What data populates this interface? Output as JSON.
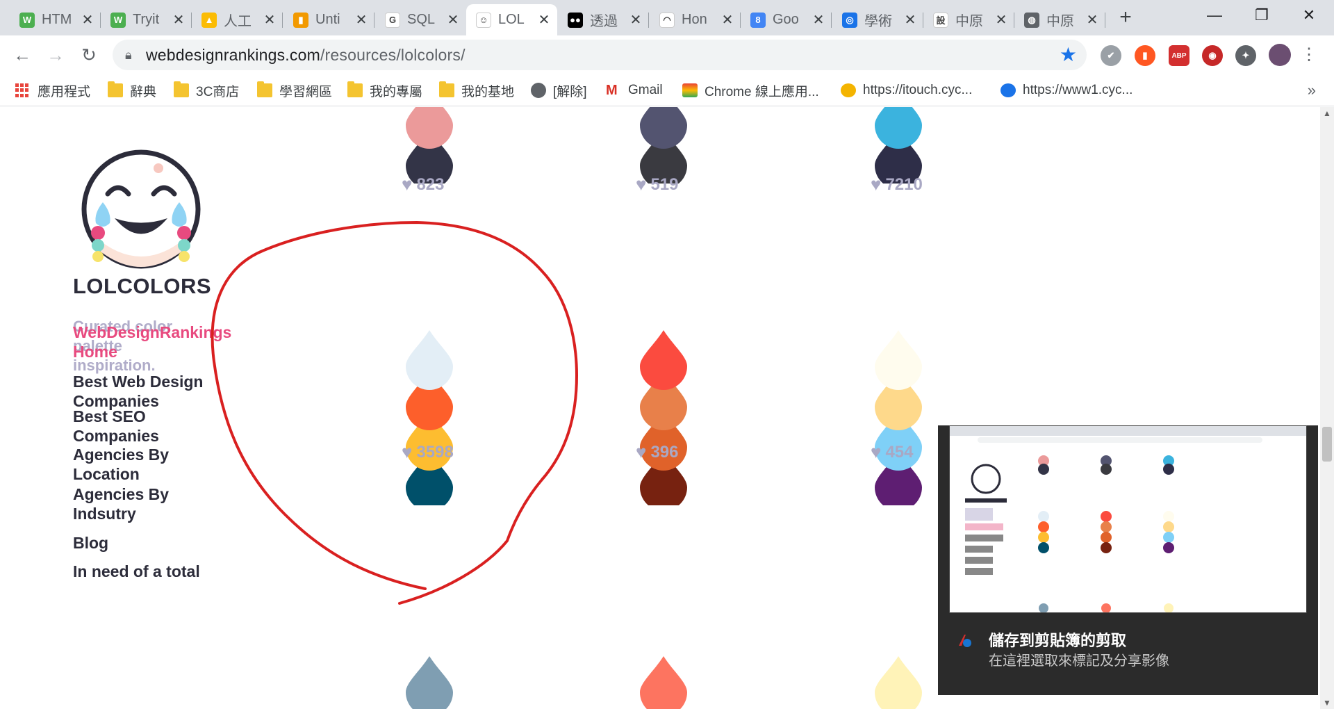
{
  "browser": {
    "tabs": [
      {
        "title": "HTM",
        "favicon_text": "W",
        "favicon_color": "#4caf50"
      },
      {
        "title": "Tryit",
        "favicon_text": "W",
        "favicon_color": "#4caf50"
      },
      {
        "title": "人工",
        "favicon_text": "▲",
        "favicon_color": "#fbbc04"
      },
      {
        "title": "Unti",
        "favicon_text": "▮",
        "favicon_color": "#f29900"
      },
      {
        "title": "SQL",
        "favicon_text": "G",
        "favicon_color": "#ffffff"
      },
      {
        "title": "LOL",
        "favicon_text": "☺",
        "favicon_color": "#ffffff"
      },
      {
        "title": "透過",
        "favicon_text": "●●",
        "favicon_color": "#000000"
      },
      {
        "title": "Hon",
        "favicon_text": "◠",
        "favicon_color": "#ffffff"
      },
      {
        "title": "Goo",
        "favicon_text": "8",
        "favicon_color": "#4285f4"
      },
      {
        "title": "學術",
        "favicon_text": "◎",
        "favicon_color": "#1a73e8"
      },
      {
        "title": "中原",
        "favicon_text": "設",
        "favicon_color": "#ffffff"
      },
      {
        "title": "中原",
        "favicon_text": "◍",
        "favicon_color": "#5f6368"
      }
    ],
    "url_host": "webdesignrankings.com",
    "url_path": "/resources/lolcolors/",
    "window_controls": {
      "minimize": "—",
      "restore": "❐",
      "close": "✕"
    },
    "extensions": [
      {
        "name": "check-extension-icon",
        "text": "✔",
        "color": "#9aa0a6"
      },
      {
        "name": "bar-extension-icon",
        "text": "▮",
        "color": "#ff5722"
      },
      {
        "name": "adblock-extension-icon",
        "text": "ABP",
        "color": "#d32f2f"
      },
      {
        "name": "wifi-extension-icon",
        "text": "◉",
        "color": "#c62828"
      },
      {
        "name": "puzzle-extension-icon",
        "text": "✦",
        "color": "#5f6368"
      }
    ]
  },
  "bookmarks": [
    {
      "label": "應用程式",
      "kind": "apps"
    },
    {
      "label": "辭典",
      "kind": "folder"
    },
    {
      "label": "3C商店",
      "kind": "folder"
    },
    {
      "label": "學習網區",
      "kind": "folder"
    },
    {
      "label": "我的專屬",
      "kind": "folder"
    },
    {
      "label": "我的基地",
      "kind": "folder"
    },
    {
      "label": "[解除]",
      "kind": "globe"
    },
    {
      "label": "Gmail",
      "kind": "gmail"
    },
    {
      "label": "Chrome 線上應用...",
      "kind": "chrome"
    },
    {
      "label": "https://itouch.cyc...",
      "kind": "tiger"
    },
    {
      "label": "https://www1.cyc...",
      "kind": "badge"
    }
  ],
  "sidebar": {
    "brand": "LOLCOLORS",
    "tagline": "Curated color palette inspiration.",
    "links": [
      {
        "label": "WebDesignRankings Home",
        "style": "pink"
      },
      {
        "label": "Best Web Design Companies",
        "style": "dark"
      },
      {
        "label": "Best SEO Companies",
        "style": "dark"
      },
      {
        "label": "Agencies By Location",
        "style": "dark"
      },
      {
        "label": "Agencies By Indsutry",
        "style": "dark"
      },
      {
        "label": "Blog",
        "style": "dark"
      },
      {
        "label": "In need of a total",
        "style": "dark"
      }
    ]
  },
  "palettes": [
    {
      "colors": [
        "#eb9a9a",
        "#333447"
      ],
      "likes": "823"
    },
    {
      "colors": [
        "#535470",
        "#3a3a40"
      ],
      "likes": "519"
    },
    {
      "colors": [
        "#3bb3de",
        "#2e2e48"
      ],
      "likes": "7210"
    },
    {
      "colors": [
        "#e3eef6",
        "#fd5f2b",
        "#fdbd30",
        "#00506a"
      ],
      "likes": "3598"
    },
    {
      "colors": [
        "#fb4b3f",
        "#e8804a",
        "#e0622a",
        "#772210"
      ],
      "likes": "396"
    },
    {
      "colors": [
        "#fffcee",
        "#fed98b",
        "#7fd0f7",
        "#5e1e72"
      ],
      "likes": "454"
    },
    {
      "colors": [
        "#7f9eb2"
      ],
      "likes": ""
    },
    {
      "colors": [
        "#fd7460"
      ],
      "likes": ""
    },
    {
      "colors": [
        "#fff3b8"
      ],
      "likes": ""
    }
  ],
  "toast": {
    "title": "儲存到剪貼簿的剪取",
    "subtitle": "在這裡選取來標記及分享影像"
  },
  "colors": {
    "annotation": "#d92020",
    "brand_pink": "#e84a7f",
    "tagline": "#b0acc9",
    "likes": "#a9a8c4"
  }
}
